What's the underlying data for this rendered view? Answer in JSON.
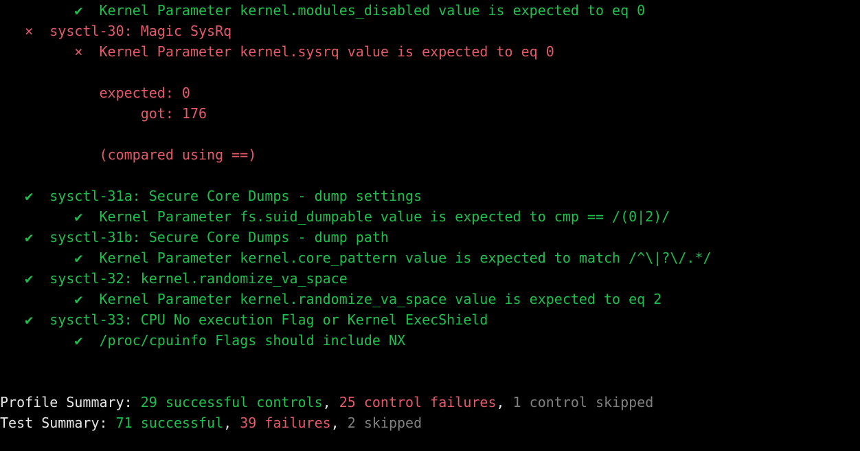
{
  "lines": [
    {
      "indent": 2,
      "mark": {
        "glyph": "✔",
        "cls": "green"
      },
      "body": {
        "cls": "green",
        "text": "Kernel Parameter kernel.modules_disabled value is expected to eq 0"
      }
    },
    {
      "indent": 0,
      "mark": {
        "glyph": "×",
        "cls": "red"
      },
      "body": {
        "cls": "red",
        "text": "sysctl-30: Magic SysRq"
      }
    },
    {
      "indent": 2,
      "mark": {
        "glyph": "×",
        "cls": "red"
      },
      "body": {
        "cls": "red",
        "text": "Kernel Parameter kernel.sysrq value is expected to eq 0"
      }
    },
    {
      "raw": " "
    },
    {
      "indent": 2,
      "body": {
        "cls": "red",
        "text": "expected: 0"
      }
    },
    {
      "indent": 2,
      "body": {
        "cls": "red",
        "text": "     got: 176"
      }
    },
    {
      "raw": " "
    },
    {
      "indent": 2,
      "body": {
        "cls": "red",
        "text": "(compared using ==)"
      }
    },
    {
      "raw": " "
    },
    {
      "indent": 0,
      "mark": {
        "glyph": "✔",
        "cls": "green"
      },
      "body": {
        "cls": "green",
        "text": "sysctl-31a: Secure Core Dumps - dump settings"
      }
    },
    {
      "indent": 2,
      "mark": {
        "glyph": "✔",
        "cls": "green"
      },
      "body": {
        "cls": "green",
        "text": "Kernel Parameter fs.suid_dumpable value is expected to cmp == /(0|2)/"
      }
    },
    {
      "indent": 0,
      "mark": {
        "glyph": "✔",
        "cls": "green"
      },
      "body": {
        "cls": "green",
        "text": "sysctl-31b: Secure Core Dumps - dump path"
      }
    },
    {
      "indent": 2,
      "mark": {
        "glyph": "✔",
        "cls": "green"
      },
      "body": {
        "cls": "green",
        "text": "Kernel Parameter kernel.core_pattern value is expected to match /^\\|?\\/.*/"
      }
    },
    {
      "indent": 0,
      "mark": {
        "glyph": "✔",
        "cls": "green"
      },
      "body": {
        "cls": "green",
        "text": "sysctl-32: kernel.randomize_va_space"
      }
    },
    {
      "indent": 2,
      "mark": {
        "glyph": "✔",
        "cls": "green"
      },
      "body": {
        "cls": "green",
        "text": "Kernel Parameter kernel.randomize_va_space value is expected to eq 2"
      }
    },
    {
      "indent": 0,
      "mark": {
        "glyph": "✔",
        "cls": "green"
      },
      "body": {
        "cls": "green",
        "text": "sysctl-33: CPU No execution Flag or Kernel ExecShield"
      }
    },
    {
      "indent": 2,
      "mark": {
        "glyph": "✔",
        "cls": "green"
      },
      "body": {
        "cls": "green",
        "text": "/proc/cpuinfo Flags should include NX"
      }
    },
    {
      "raw": " "
    },
    {
      "raw": " "
    }
  ],
  "profile_summary": {
    "label": "Profile Summary: ",
    "success": "29 successful controls",
    "sep1": ", ",
    "fail": "25 control failures",
    "sep2": ", ",
    "skip": "1 control skipped"
  },
  "test_summary": {
    "label": "Test Summary: ",
    "success": "71 successful",
    "sep1": ", ",
    "fail": "39 failures",
    "sep2": ", ",
    "skip": "2 skipped"
  }
}
